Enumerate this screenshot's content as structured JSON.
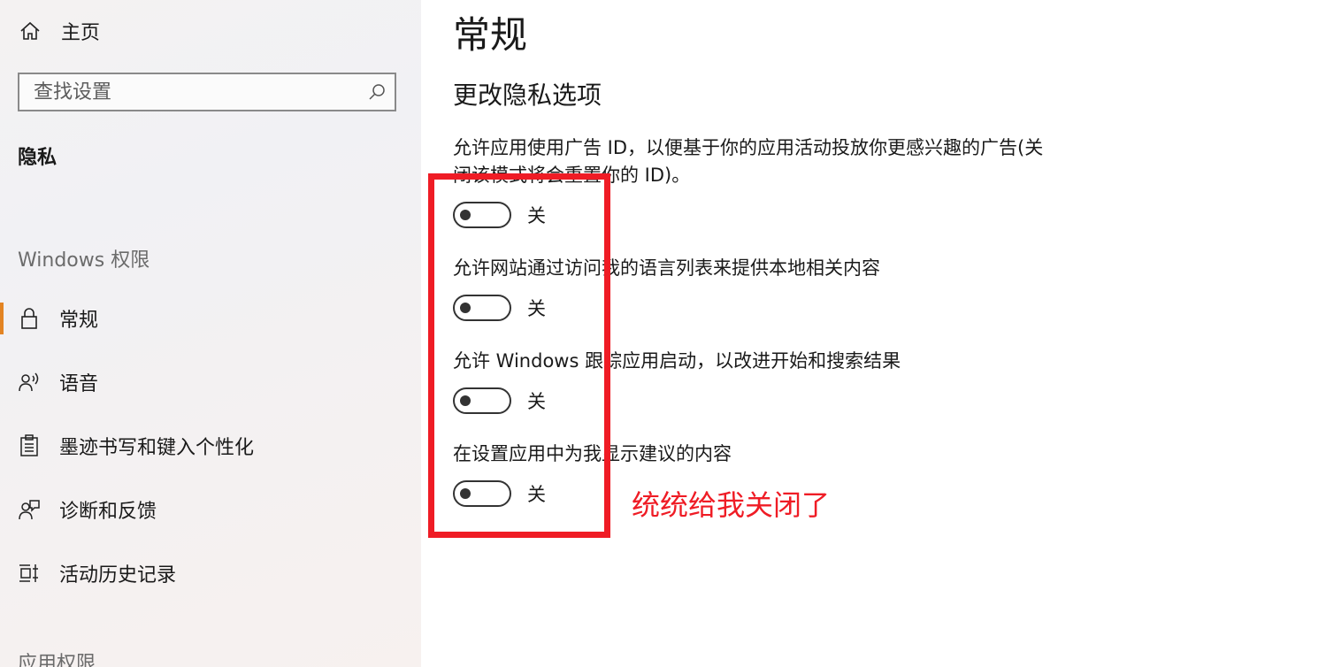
{
  "sidebar": {
    "home_label": "主页",
    "search_placeholder": "查找设置",
    "current_section": "隐私",
    "windows_permissions_header": "Windows 权限",
    "items": [
      {
        "label": "常规",
        "icon": "lock-icon",
        "selected": true
      },
      {
        "label": "语音",
        "icon": "speech-icon"
      },
      {
        "label": "墨迹书写和键入个性化",
        "icon": "clipboard-icon"
      },
      {
        "label": "诊断和反馈",
        "icon": "feedback-icon"
      },
      {
        "label": "活动历史记录",
        "icon": "timeline-icon"
      }
    ],
    "app_permissions_header": "应用权限"
  },
  "main": {
    "title": "常规",
    "subtitle": "更改隐私选项",
    "settings": [
      {
        "desc": "允许应用使用广告 ID，以便基于你的应用活动投放你更感兴趣的广告(关闭该模式将会重置你的 ID)。",
        "state": "关"
      },
      {
        "desc": "允许网站通过访问我的语言列表来提供本地相关内容",
        "state": "关"
      },
      {
        "desc": "允许 Windows 跟踪应用启动，以改进开始和搜索结果",
        "state": "关"
      },
      {
        "desc": "在设置应用中为我显示建议的内容",
        "state": "关"
      }
    ]
  },
  "annotation": {
    "text": "统统给我关闭了",
    "color": "#ef1c25"
  },
  "colors": {
    "accent": "#e38423",
    "toggle_off": "#333333"
  }
}
